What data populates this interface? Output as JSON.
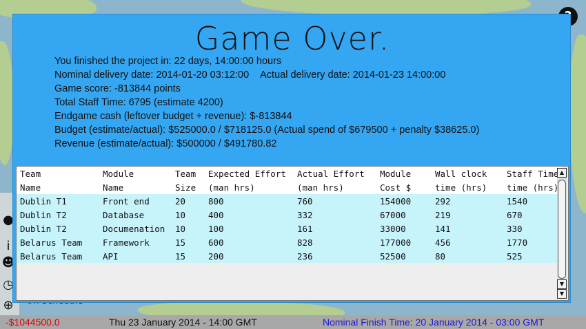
{
  "title": "Game Over.",
  "summary": {
    "finished": "You finished the project in: 22 days, 14:00:00 hours",
    "nominal_delivery": "Nominal delivery date: 2014-01-20 03:12:00",
    "actual_delivery": "Actual delivery date: 2014-01-23 14:00:00",
    "score": "Game score: -813844 points",
    "staff_time": "Total Staff Time: 6795 (estimate 4200)",
    "endgame_cash": "Endgame cash (leftover budget + revenue): $-813844",
    "budget": "Budget (estimate/actual): $525000.0 / $718125.0 (Actual spend of $679500 + penalty $38625.0)",
    "revenue": "Revenue (estimate/actual): $500000 / $491780.82"
  },
  "table": {
    "headers_line1": [
      "Team",
      "Module",
      "Team",
      "Expected Effort",
      "Actual Effort",
      "Module",
      "Wall clock",
      "Staff Time"
    ],
    "headers_line2": [
      "Name",
      "Name",
      "Size",
      "(man hrs)",
      "(man hrs)",
      "Cost $",
      "time (hrs)",
      "time (hrs)"
    ],
    "rows": [
      [
        "Dublin T1",
        "Front end",
        "20",
        "800",
        "760",
        "154000",
        "292",
        "1540"
      ],
      [
        "Dublin T2",
        "Database",
        "10",
        "400",
        "332",
        "67000",
        "219",
        "670"
      ],
      [
        "Dublin T2",
        "Documenation",
        "10",
        "100",
        "161",
        "33000",
        "141",
        "330"
      ],
      [
        "Belarus Team",
        "Framework",
        "15",
        "600",
        "828",
        "177000",
        "456",
        "1770"
      ],
      [
        "Belarus Team",
        "API",
        "15",
        "200",
        "236",
        "52500",
        "80",
        "525"
      ]
    ]
  },
  "background": {
    "schedule_label": "On Schedule",
    "help_label": "?",
    "side_icons": [
      "location-pin-icon",
      "info-icon",
      "people-icon",
      "clock-icon",
      "crosshair-icon"
    ]
  },
  "status_bar": {
    "cash": "-$1044500.0",
    "date": "Thu 23 January 2014 - 14:00 GMT",
    "nominal_finish": "Nominal Finish Time: 20 January 2014 - 03:00 GMT"
  },
  "colors": {
    "dialog_bg": "#35a6f2",
    "row_bg": "#c7f3fb",
    "cash": "#e30000",
    "nominal": "#1a1ad6"
  }
}
